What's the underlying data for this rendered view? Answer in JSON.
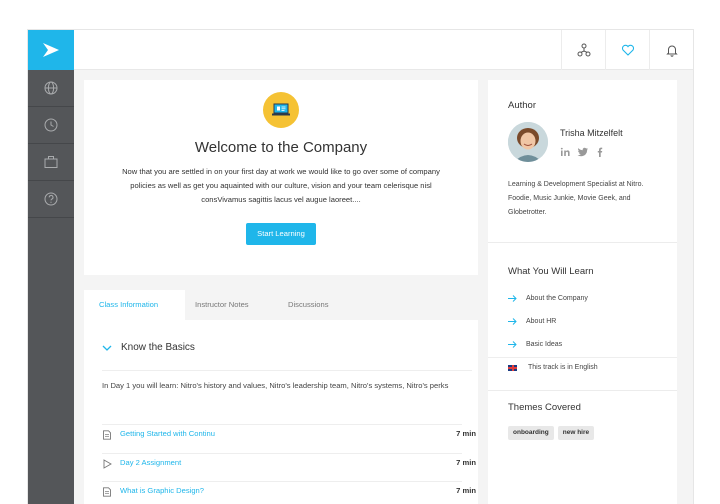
{
  "nav": {
    "items": [
      {
        "icon": "globe-icon"
      },
      {
        "icon": "clock-icon"
      },
      {
        "icon": "briefcase-icon"
      },
      {
        "icon": "help-icon"
      }
    ]
  },
  "topbar": {
    "actions": [
      {
        "icon": "network-icon"
      },
      {
        "icon": "heart-icon"
      },
      {
        "icon": "bell-icon"
      }
    ]
  },
  "welcome": {
    "title": "Welcome to the Company",
    "body": "Now that you are settled in on your first day at work we would like to go over some of company policies as well as get you aquainted with our culture, vision and your team celerisque nisl consVivamus sagittis lacus vel augue laoreet....",
    "cta_label": "Start Learning"
  },
  "tabs": [
    "Class Information",
    "Instructor Notes",
    "Discussions"
  ],
  "section": {
    "title": "Know the Basics",
    "description": "In Day 1 you will learn: Nitro's history and values, Nitro's leadership team, Nitro's systems, Nitro's perks",
    "items": [
      {
        "title": "Getting Started with Continu",
        "duration": "7 min",
        "icon": "document-icon"
      },
      {
        "title": "Day 2 Assignment",
        "duration": "7 min",
        "icon": "play-icon"
      },
      {
        "title": "What is Graphic Design?",
        "duration": "7 min",
        "icon": "document-icon"
      }
    ]
  },
  "author": {
    "heading": "Author",
    "name": "Trisha Mitzelfelt",
    "bio": "Learning & Development Specialist at Nitro. Foodie, Music Junkie, Movie Geek, and Globetrotter."
  },
  "learn": {
    "heading": "What You Will Learn",
    "items": [
      "About the Company",
      "About HR",
      "Basic Ideas"
    ],
    "language": "This track is in English"
  },
  "themes": {
    "heading": "Themes Covered",
    "tags": [
      "onboarding",
      "new hire"
    ]
  },
  "colors": {
    "accent": "#1fb6ea",
    "sidebar": "#545659",
    "badge": "#f5c234"
  }
}
